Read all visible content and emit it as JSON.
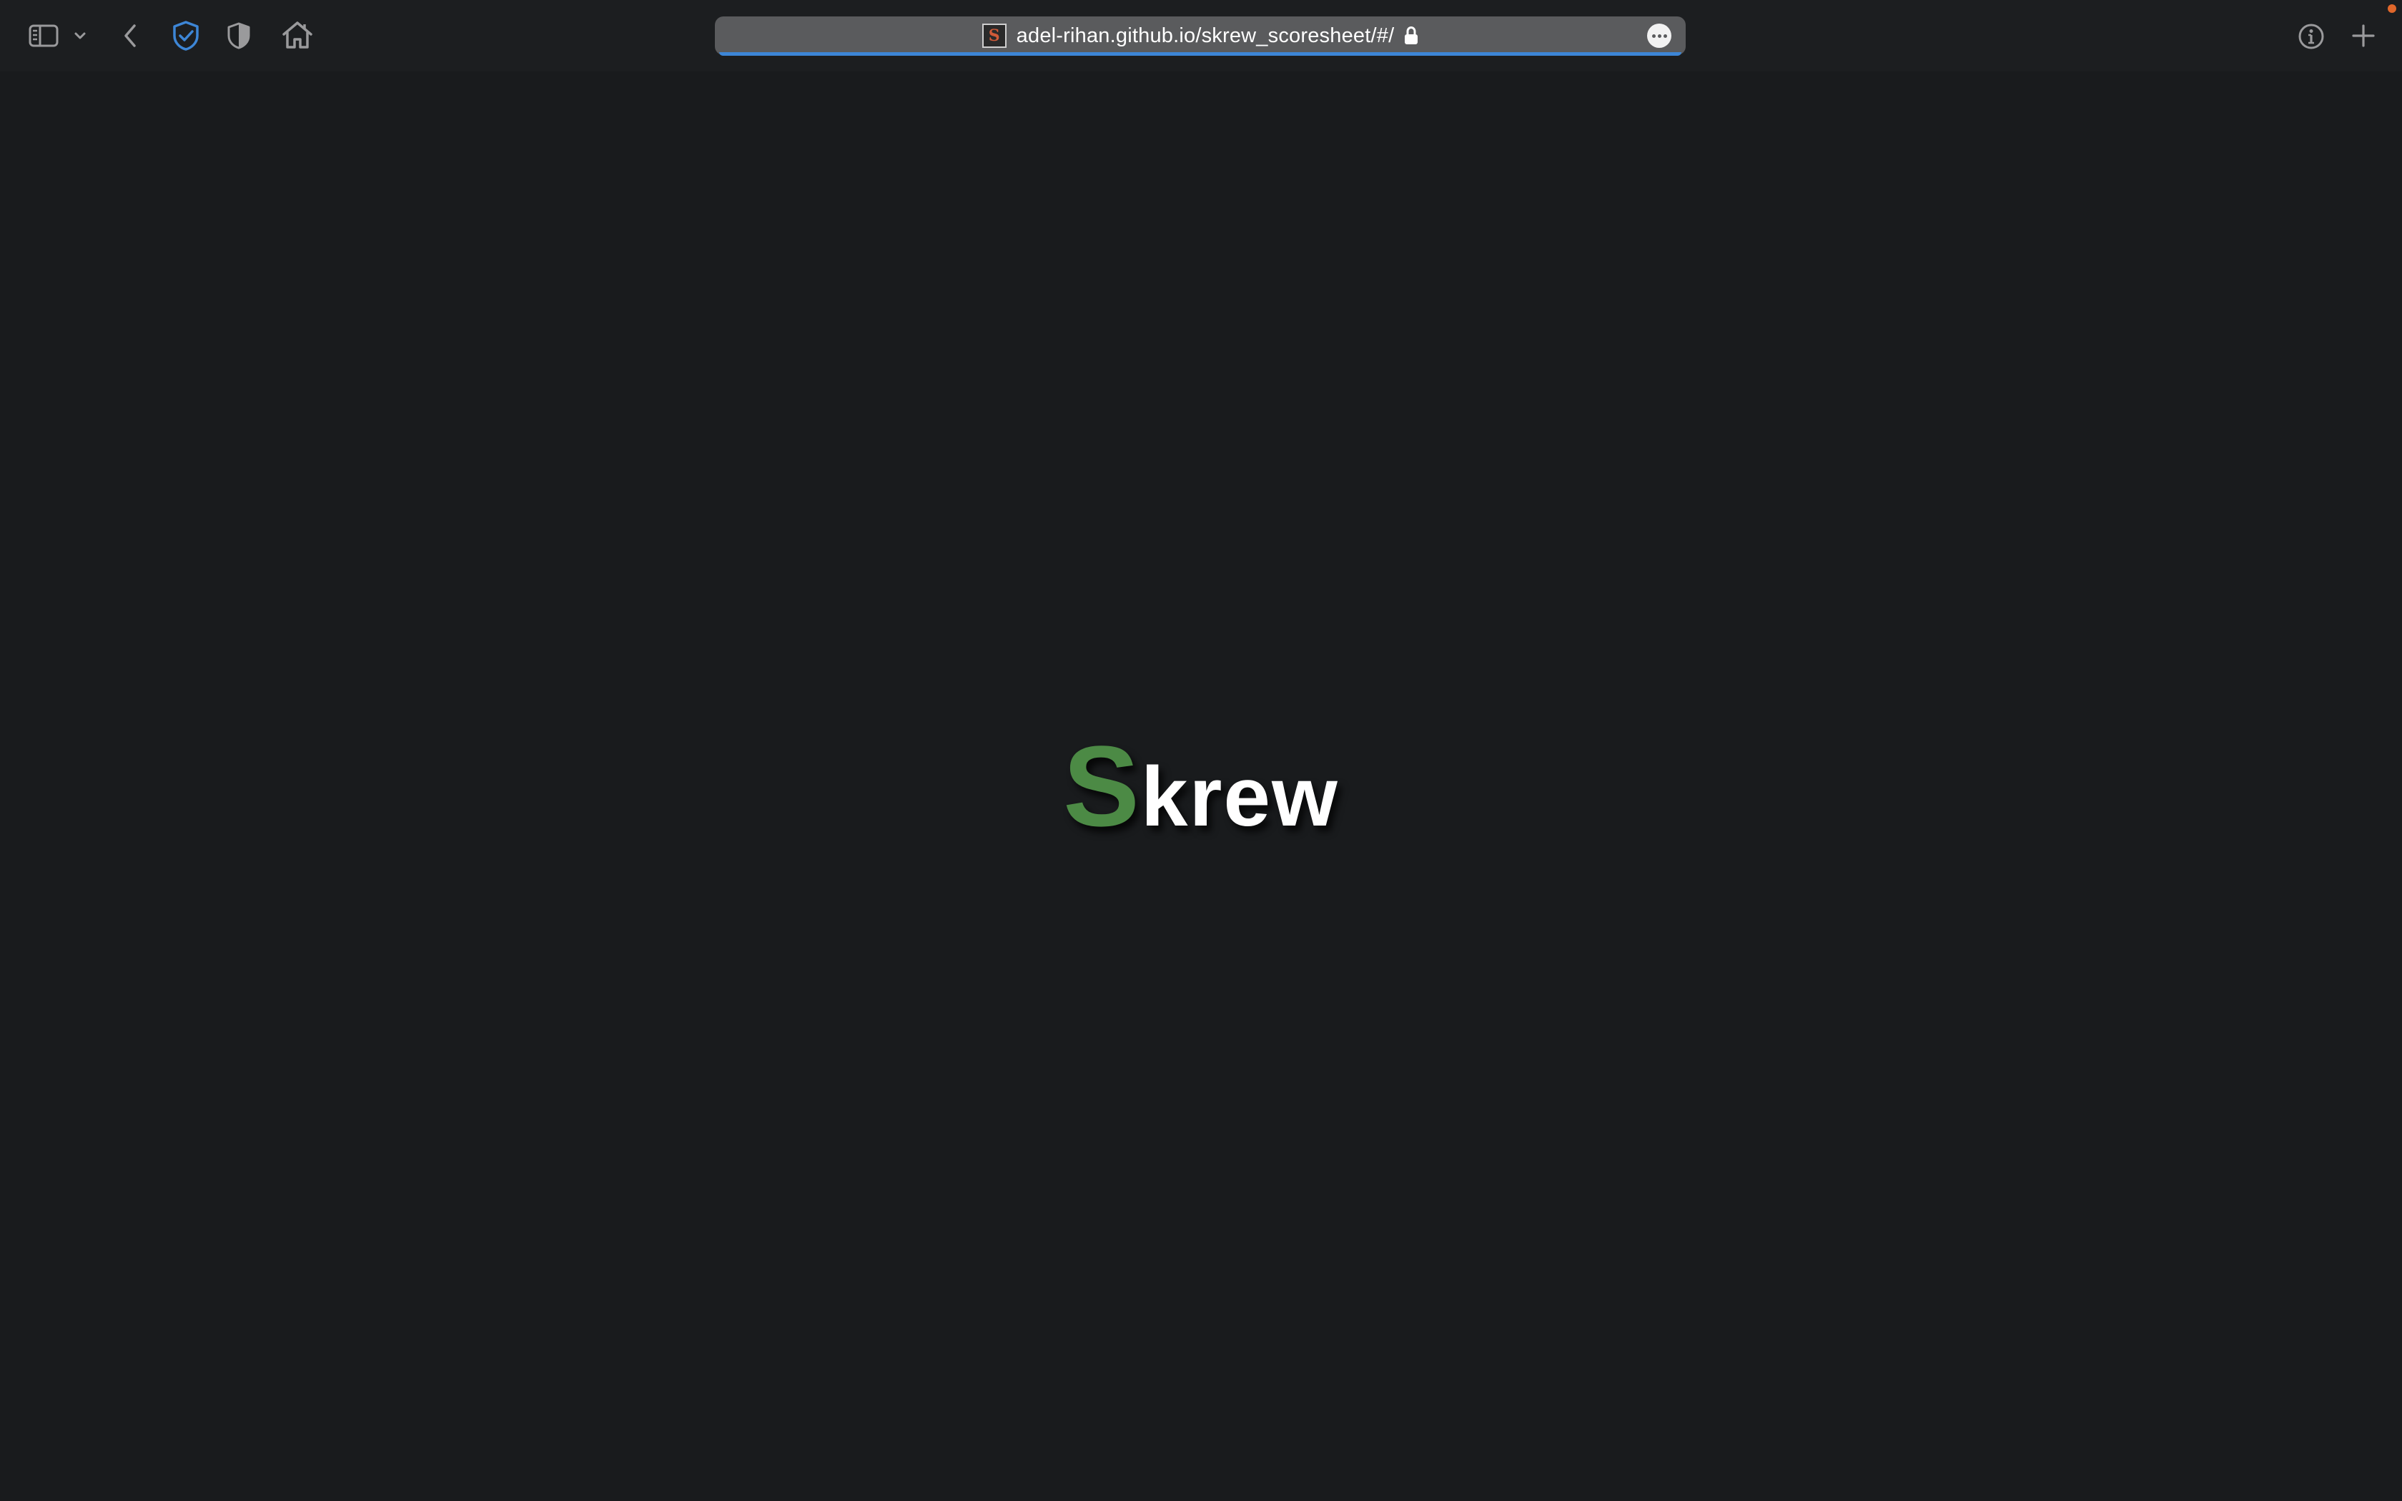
{
  "browser": {
    "url": "adel-rihan.github.io/skrew_scoresheet/#/",
    "favicon_letter": "S",
    "accent_color": "#3d86d6",
    "notification_color": "#e0672b",
    "toolbar_icons": [
      "sidebar-icon",
      "chevron-down-icon",
      "back-icon",
      "shield-check-icon",
      "privacy-shield-icon",
      "home-icon",
      "lock-icon",
      "more-icon",
      "info-icon",
      "plus-icon"
    ]
  },
  "page": {
    "logo_first": "S",
    "logo_rest": "krew",
    "logo_first_color": "#4c8a45",
    "background_color": "#191b1d"
  }
}
